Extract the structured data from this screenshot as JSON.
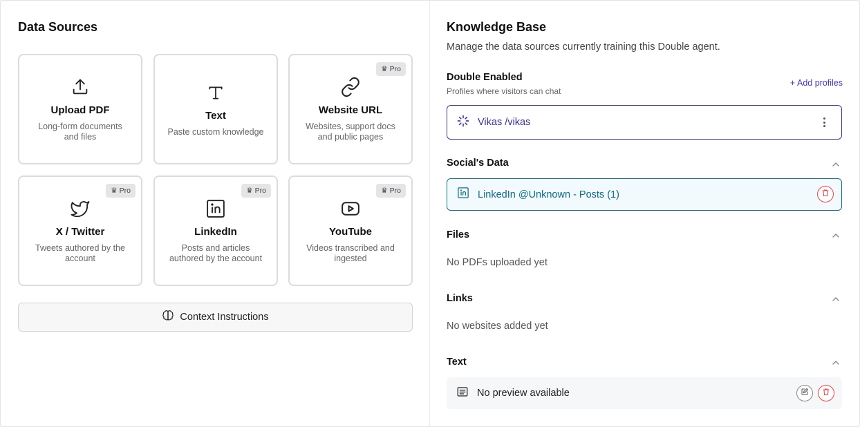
{
  "data_sources": {
    "title": "Data Sources",
    "cards": [
      {
        "icon": "upload-icon",
        "title": "Upload PDF",
        "desc": "Long-form documents and files",
        "pro": ""
      },
      {
        "icon": "text-icon",
        "title": "Text",
        "desc": "Paste custom knowledge",
        "pro": ""
      },
      {
        "icon": "link-icon",
        "title": "Website URL",
        "desc": "Websites, support docs and public pages",
        "pro": "Pro"
      },
      {
        "icon": "twitter-icon",
        "title": "X / Twitter",
        "desc": "Tweets authored by the account",
        "pro": "Pro"
      },
      {
        "icon": "linkedin-icon",
        "title": "LinkedIn",
        "desc": "Posts and articles authored by the account",
        "pro": "Pro"
      },
      {
        "icon": "youtube-icon",
        "title": "YouTube",
        "desc": "Videos transcribed and ingested",
        "pro": "Pro"
      }
    ],
    "context_button": "Context Instructions"
  },
  "knowledge_base": {
    "title": "Knowledge Base",
    "subtitle": "Manage the data sources currently training this Double agent.",
    "double_enabled": {
      "title": "Double Enabled",
      "subtitle": "Profiles where visitors can chat",
      "add_label": "+ Add profiles",
      "profile": "Vikas /vikas"
    },
    "socials": {
      "title": "Social's Data",
      "item": "LinkedIn @Unknown - Posts (1)"
    },
    "files": {
      "title": "Files",
      "empty": "No PDFs uploaded yet"
    },
    "links": {
      "title": "Links",
      "empty": "No websites added yet"
    },
    "text": {
      "title": "Text",
      "item": "No preview available"
    }
  },
  "colors": {
    "accent": "#3b3ab0",
    "social": "#0e7490",
    "danger": "#ef4444"
  }
}
